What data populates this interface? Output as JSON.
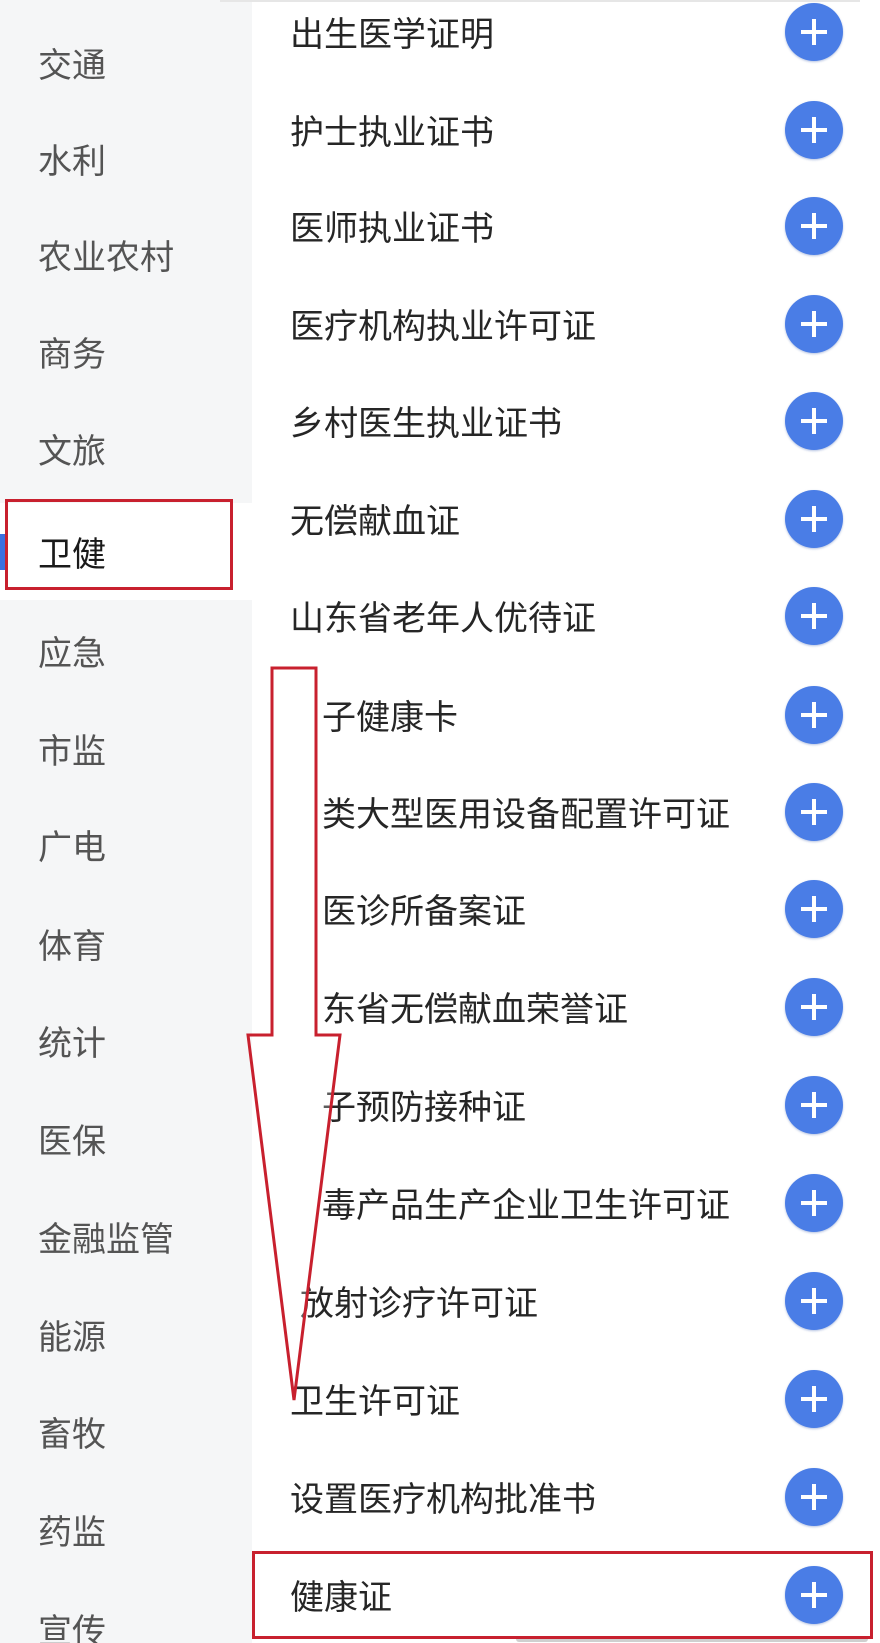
{
  "sidebar": {
    "items": [
      {
        "label": "交通"
      },
      {
        "label": "水利"
      },
      {
        "label": "农业农村"
      },
      {
        "label": "商务"
      },
      {
        "label": "文旅"
      },
      {
        "label": "卫健",
        "active": true
      },
      {
        "label": "应急"
      },
      {
        "label": "市监"
      },
      {
        "label": "广电"
      },
      {
        "label": "体育"
      },
      {
        "label": "统计"
      },
      {
        "label": "医保"
      },
      {
        "label": "金融监管"
      },
      {
        "label": "能源"
      },
      {
        "label": "畜牧"
      },
      {
        "label": "药监"
      },
      {
        "label": "宣传"
      }
    ]
  },
  "main": {
    "add_icon": "plus-icon",
    "items": [
      {
        "label": "出生医学证明"
      },
      {
        "label": "护士执业证书"
      },
      {
        "label": "医师执业证书"
      },
      {
        "label": "医疗机构执业许可证"
      },
      {
        "label": "乡村医生执业证书"
      },
      {
        "label": "无偿献血证"
      },
      {
        "label": "山东省老年人优待证"
      },
      {
        "label": "子健康卡"
      },
      {
        "label": "类大型医用设备配置许可证"
      },
      {
        "label": "医诊所备案证"
      },
      {
        "label": "东省无偿献血荣誉证"
      },
      {
        "label": "子预防接种证"
      },
      {
        "label": "毒产品生产企业卫生许可证"
      },
      {
        "label": "放射诊疗许可证"
      },
      {
        "label": "卫生许可证"
      },
      {
        "label": "设置医疗机构批准书"
      },
      {
        "label": "健康证"
      }
    ]
  },
  "colors": {
    "accent": "#4a7de6",
    "annotation": "#c8202e",
    "sidebar_bg": "#f5f6f7"
  }
}
